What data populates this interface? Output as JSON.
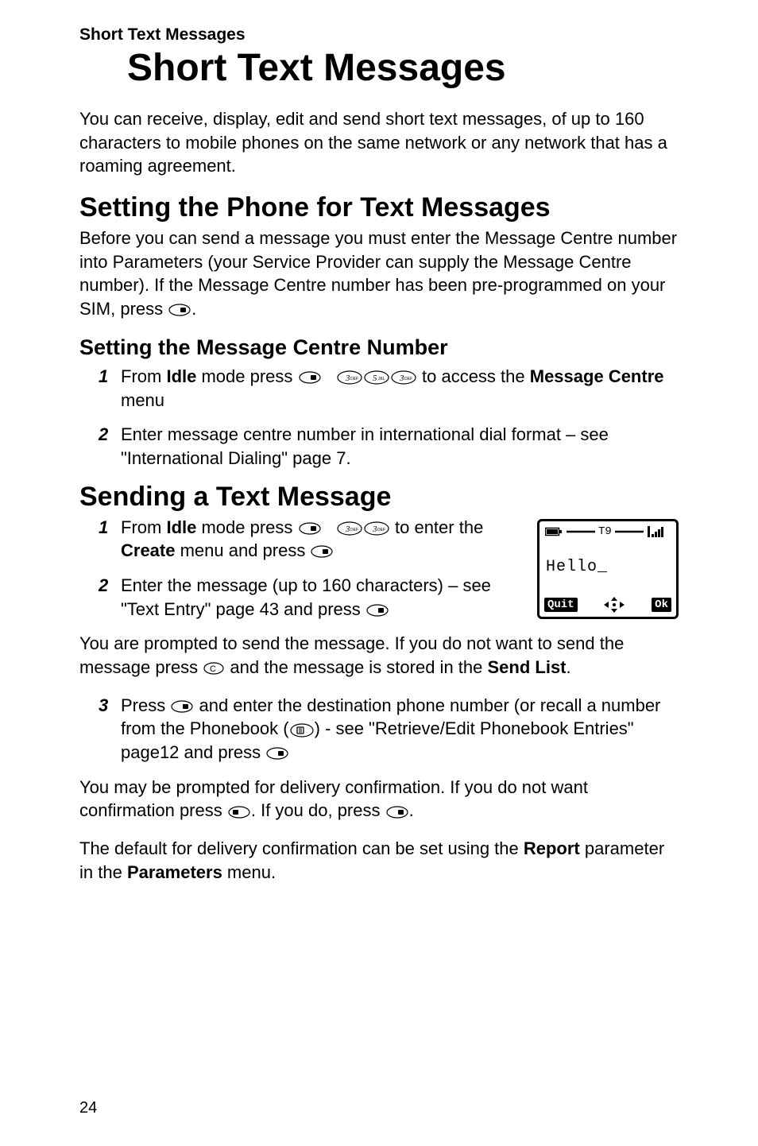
{
  "running_head": "Short Text Messages",
  "title": "Short Text Messages",
  "intro": "You can receive, display, edit and send short text messages, of up to 160 characters to mobile phones on the same network or any network that has a roaming agreement.",
  "section_setting": {
    "heading": "Setting the Phone for Text Messages",
    "intro_a": "Before you can send a message you must enter the Message Centre number into Parameters (your Service Provider can supply the Message Centre number). If the Message Centre number has been pre-programmed on your SIM,  press ",
    "intro_b": "."
  },
  "subsection_centre": {
    "heading": "Setting the Message Centre Number",
    "step1_a": "From ",
    "step1_idle": "Idle",
    "step1_b": " mode press ",
    "step1_c": " to access the ",
    "step1_message": "Message Centre",
    "step1_d": " menu",
    "step2": "Enter message centre number in international dial format – see \"International Dialing\" page 7."
  },
  "section_send": {
    "heading": "Sending a Text Message",
    "step1_a": "From ",
    "step1_idle": "Idle",
    "step1_b": " mode press ",
    "step1_c": " to enter the ",
    "step1_create": "Create",
    "step1_d": " menu and press ",
    "step2_a": "Enter the message (up to 160 characters) – see \"Text Entry\" page 43 and press ",
    "after_a": "You are prompted to send the message. If you do not want to send the message press ",
    "after_b": " and the message is stored in the ",
    "after_sendlist": "Send List",
    "after_c": ".",
    "step3_a": "Press ",
    "step3_b": " and enter the destination phone number (or recall a number from the Phonebook (",
    "step3_c": ") - see \"Retrieve/Edit Phonebook Entries\" page12 and press ",
    "conf_a": "You may be prompted for delivery confirmation. If you do not want confirmation press ",
    "conf_b": ". If you do, press ",
    "conf_c": ".",
    "report_a": "The default for delivery confirmation can be set using the ",
    "report_b": "Report",
    "report_c": " parameter in the ",
    "report_d": "Parameters",
    "report_e": " menu."
  },
  "phone_figure": {
    "t9": "T9",
    "text": "Hello_",
    "quit": "Quit",
    "ok": "Ok"
  },
  "page_number": "24",
  "keys": {
    "three": "3",
    "three_sub": "DEF",
    "five": "5",
    "five_sub": "JKL"
  }
}
